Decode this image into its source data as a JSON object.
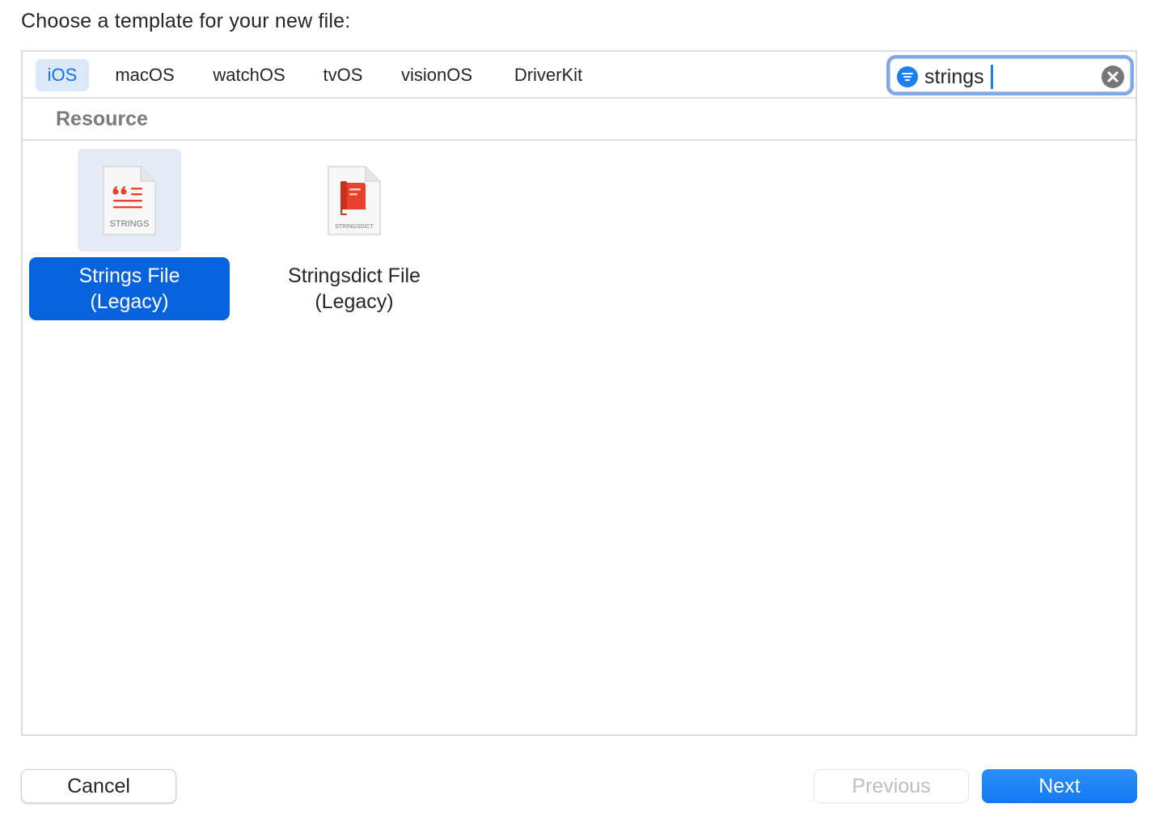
{
  "dialog": {
    "prompt": "Choose a template for your new file:"
  },
  "tabs": [
    {
      "label": "iOS",
      "selected": true
    },
    {
      "label": "macOS",
      "selected": false
    },
    {
      "label": "watchOS",
      "selected": false
    },
    {
      "label": "tvOS",
      "selected": false
    },
    {
      "label": "visionOS",
      "selected": false
    },
    {
      "label": "DriverKit",
      "selected": false
    }
  ],
  "search": {
    "value": "strings",
    "filter_icon": "filter-icon",
    "clear_icon": "clear-icon"
  },
  "section": {
    "title": "Resource"
  },
  "templates": [
    {
      "name_line1": "Strings File",
      "name_line2": "(Legacy)",
      "icon_caption": "STRINGS",
      "icon": "strings-file-icon",
      "selected": true
    },
    {
      "name_line1": "Stringsdict File",
      "name_line2": "(Legacy)",
      "icon_caption": "STRINGSDICT",
      "icon": "stringsdict-file-icon",
      "selected": false
    }
  ],
  "buttons": {
    "cancel": "Cancel",
    "previous": "Previous",
    "next": "Next"
  },
  "colors": {
    "accent": "#1a7ff0",
    "selection": "#0762dd",
    "icon_red": "#e8412c"
  }
}
